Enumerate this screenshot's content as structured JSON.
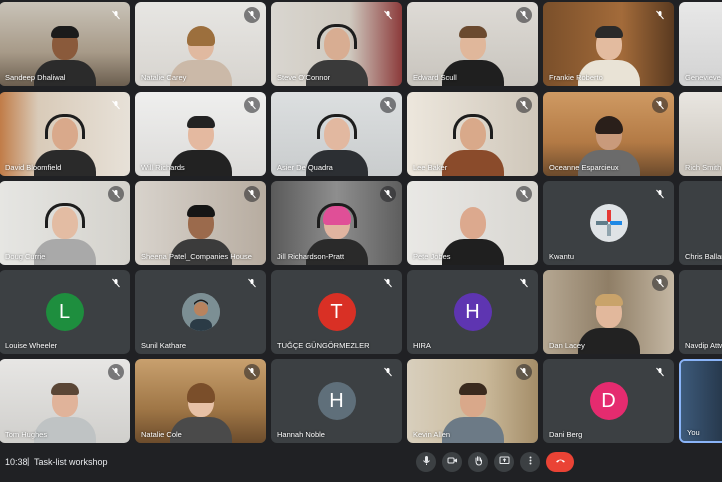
{
  "participants": [
    {
      "name": "Sandeep Dhaliwal"
    },
    {
      "name": "Natalie Carey"
    },
    {
      "name": "Steve O'Connor"
    },
    {
      "name": "Edward Scull"
    },
    {
      "name": "Frankie Roberto"
    },
    {
      "name": "Genevieve"
    },
    {
      "name": "David Bloomfield"
    },
    {
      "name": "Will Richards"
    },
    {
      "name": "Asier De Quadra"
    },
    {
      "name": "Lee Baker"
    },
    {
      "name": "Oceanne Esparcieux"
    },
    {
      "name": "Rich Smith"
    },
    {
      "name": "Doug Currie"
    },
    {
      "name": "Sheena Patel_Companies House"
    },
    {
      "name": "Jill Richardson-Pratt"
    },
    {
      "name": "Pete Jobes"
    },
    {
      "name": "Kwantu"
    },
    {
      "name": "Chris Ballantine"
    },
    {
      "name": "Louise Wheeler",
      "initial": "L",
      "color": "#1e8e3e"
    },
    {
      "name": "Sunil Kathare"
    },
    {
      "name": "TUĞÇE GÜNGÖRMEZLER",
      "initial": "T",
      "color": "#d93025"
    },
    {
      "name": "HIRA",
      "initial": "H",
      "color": "#5e35b1"
    },
    {
      "name": "Dan Lacey"
    },
    {
      "name": "Navdip Attwal"
    },
    {
      "name": "Tom Hughes"
    },
    {
      "name": "Natalie Cole"
    },
    {
      "name": "Hannah Noble",
      "initial": "H",
      "color": "#5f6f7a"
    },
    {
      "name": "Kevin Allen"
    },
    {
      "name": "Dani Berg",
      "initial": "D",
      "color": "#e52b6f"
    },
    {
      "name": "You"
    }
  ],
  "bottom_bar": {
    "time": "10:38",
    "separator": "|",
    "meeting_title": "Task-list workshop"
  },
  "controls": [
    {
      "icon": "microphone-icon"
    },
    {
      "icon": "camera-icon"
    },
    {
      "icon": "raise-hand-icon"
    },
    {
      "icon": "present-screen-icon"
    },
    {
      "icon": "more-options-icon"
    },
    {
      "icon": "end-call-icon",
      "color": "#ea4335"
    }
  ]
}
